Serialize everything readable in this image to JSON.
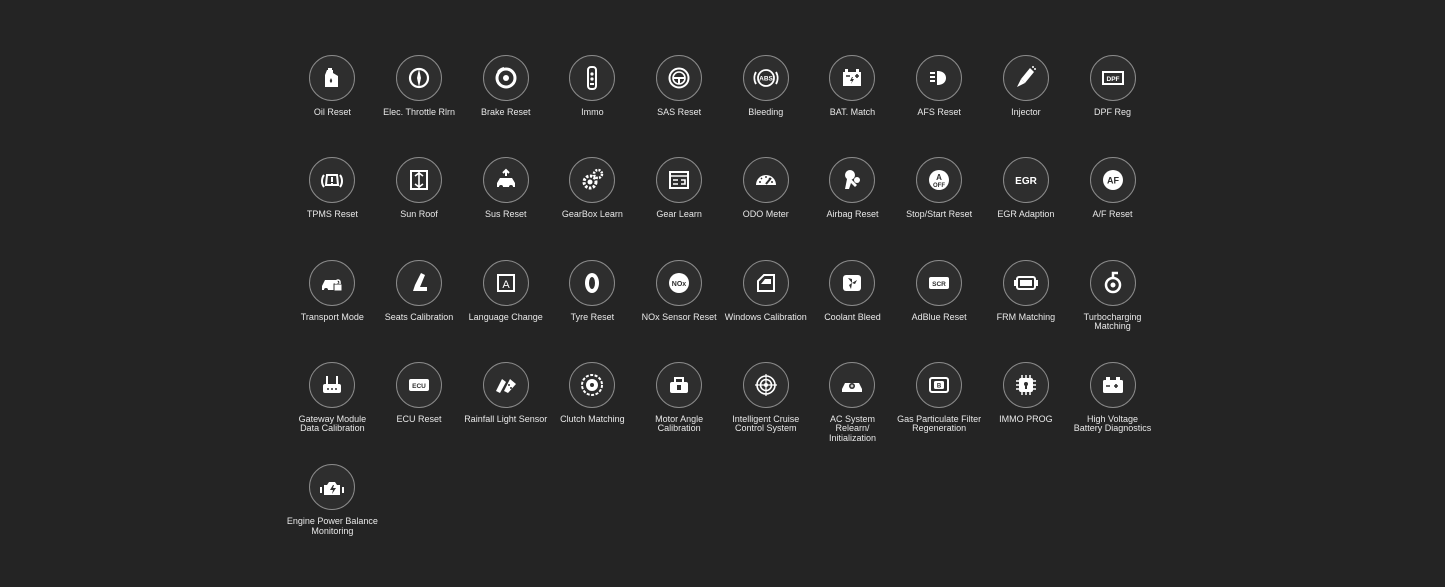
{
  "functions": [
    {
      "label": "Oil Reset",
      "icon": "oil-can-icon"
    },
    {
      "label": "Elec. Throttle Rlrn",
      "icon": "throttle-icon"
    },
    {
      "label": "Brake Reset",
      "icon": "brake-disc-icon"
    },
    {
      "label": "Immo",
      "icon": "car-key-icon"
    },
    {
      "label": "SAS Reset",
      "icon": "steering-wheel-icon"
    },
    {
      "label": "Bleeding",
      "icon": "abs-icon"
    },
    {
      "label": "BAT. Match",
      "icon": "battery-icon"
    },
    {
      "label": "AFS Reset",
      "icon": "headlight-icon"
    },
    {
      "label": "Injector",
      "icon": "injector-icon"
    },
    {
      "label": "DPF Reg",
      "icon": "dpf-icon"
    },
    {
      "label": "TPMS Reset",
      "icon": "tpms-icon"
    },
    {
      "label": "Sun Roof",
      "icon": "sunroof-icon"
    },
    {
      "label": "Sus Reset",
      "icon": "suspension-icon"
    },
    {
      "label": "GearBox Learn",
      "icon": "gears-icon"
    },
    {
      "label": "Gear Learn",
      "icon": "gear-panel-icon"
    },
    {
      "label": "ODO Meter",
      "icon": "odometer-icon"
    },
    {
      "label": "Airbag Reset",
      "icon": "airbag-icon"
    },
    {
      "label": "Stop/Start Reset",
      "icon": "auto-stop-icon"
    },
    {
      "label": "EGR Adaption",
      "icon": "egr-icon"
    },
    {
      "label": "A/F Reset",
      "icon": "af-icon"
    },
    {
      "label": "Transport Mode",
      "icon": "car-lock-icon"
    },
    {
      "label": "Seats Calibration",
      "icon": "seat-icon"
    },
    {
      "label": "Language Change",
      "icon": "language-icon"
    },
    {
      "label": "Tyre Reset",
      "icon": "tyre-icon"
    },
    {
      "label": "NOx Sensor Reset",
      "icon": "nox-icon"
    },
    {
      "label": "Windows Calibration",
      "icon": "car-window-icon"
    },
    {
      "label": "Coolant Bleed",
      "icon": "coolant-fan-icon"
    },
    {
      "label": "AdBlue Reset",
      "icon": "scr-icon"
    },
    {
      "label": "FRM Matching",
      "icon": "frm-module-icon"
    },
    {
      "label": "Turbocharging\nMatching",
      "icon": "turbo-icon"
    },
    {
      "label": "Gateway Module\nData Calibration",
      "icon": "gateway-router-icon"
    },
    {
      "label": "ECU Reset",
      "icon": "ecu-icon"
    },
    {
      "label": "Rainfall Light Sensor",
      "icon": "rain-sensor-icon"
    },
    {
      "label": "Clutch Matching",
      "icon": "clutch-icon"
    },
    {
      "label": "Motor Angle\nCalibration",
      "icon": "motor-angle-icon"
    },
    {
      "label": "Intelligent Cruise\nControl System",
      "icon": "radar-icon"
    },
    {
      "label": "AC System\nRelearn/\nInitialization",
      "icon": "ac-car-icon"
    },
    {
      "label": "Gas Particulate Filter\nRegeneration",
      "icon": "gpf-icon"
    },
    {
      "label": "IMMO PROG",
      "icon": "immo-chip-icon"
    },
    {
      "label": "High Voltage\nBattery Diagnostics",
      "icon": "hv-battery-icon"
    },
    {
      "label": "Engine Power Balance\nMonitoring",
      "icon": "engine-icon"
    }
  ]
}
